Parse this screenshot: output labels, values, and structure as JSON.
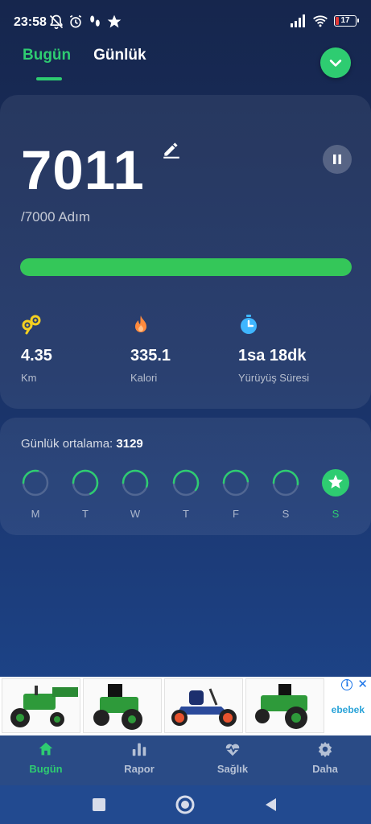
{
  "status_bar": {
    "time": "23:58",
    "battery": "17",
    "icons": [
      "bell-off-icon",
      "alarm-icon",
      "steps-icon",
      "star-icon",
      "signal-icon",
      "wifi-icon",
      "battery-icon"
    ]
  },
  "tabs": [
    {
      "label": "Bugün",
      "active": true
    },
    {
      "label": "Günlük",
      "active": false
    }
  ],
  "today": {
    "steps": "7011",
    "goal": "/7000 Adım",
    "progress": 1.0,
    "stats": [
      {
        "icon": "distance-icon",
        "value": "4.35",
        "label": "Km",
        "color": "#f5d020"
      },
      {
        "icon": "flame-icon",
        "value": "335.1",
        "label": "Kalori",
        "color": "#ff8a3d"
      },
      {
        "icon": "timer-icon",
        "value": "1sa 18dk",
        "label": "Yürüyüş Süresi",
        "color": "#3fb6ff"
      }
    ]
  },
  "weekly": {
    "avg_label": "Günlük ortalama:",
    "avg_value": "3129",
    "days": [
      {
        "label": "M",
        "progress": 0.28
      },
      {
        "label": "T",
        "progress": 0.68
      },
      {
        "label": "W",
        "progress": 0.55
      },
      {
        "label": "T",
        "progress": 0.6
      },
      {
        "label": "F",
        "progress": 0.48
      },
      {
        "label": "S",
        "progress": 0.52
      },
      {
        "label": "S",
        "progress": 1.0,
        "today": true
      }
    ]
  },
  "ad": {
    "brand": "ebebek"
  },
  "bottom_nav": [
    {
      "label": "Bugün",
      "icon": "home-icon",
      "active": true
    },
    {
      "label": "Rapor",
      "icon": "bar-chart-icon",
      "active": false
    },
    {
      "label": "Sağlık",
      "icon": "heart-pulse-icon",
      "active": false
    },
    {
      "label": "Daha",
      "icon": "gear-icon",
      "active": false
    }
  ],
  "colors": {
    "accent": "#2ecc71",
    "progress": "#34c759",
    "background_top": "#16264d",
    "background_bottom": "#1e4a95"
  }
}
